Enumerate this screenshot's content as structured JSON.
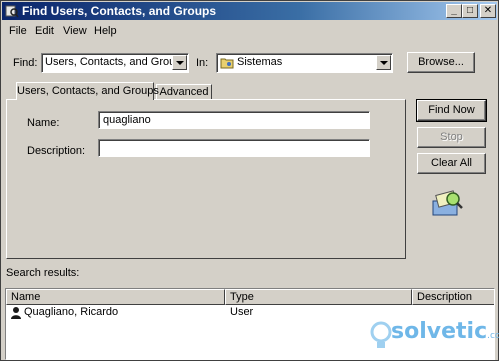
{
  "window": {
    "title": "Find Users, Contacts, and Groups",
    "controls": {
      "minimize": "_",
      "maximize": "□",
      "close": "✕"
    }
  },
  "menubar": {
    "items": [
      "File",
      "Edit",
      "View",
      "Help"
    ]
  },
  "find_row": {
    "find_label": "Find:",
    "find_value": "Users, Contacts, and Groups",
    "in_label": "In:",
    "in_value": "Sistemas",
    "browse_label": "Browse..."
  },
  "tabs": [
    {
      "label": "Users, Contacts, and Groups",
      "active": true
    },
    {
      "label": "Advanced",
      "active": false
    }
  ],
  "form": {
    "name_label": "Name:",
    "name_value": "quagliano",
    "description_label": "Description:",
    "description_value": ""
  },
  "actions": {
    "find_now": "Find Now",
    "stop": "Stop",
    "clear_all": "Clear All"
  },
  "results": {
    "label": "Search results:",
    "columns": [
      "Name",
      "Type",
      "Description"
    ],
    "rows": [
      {
        "name": "Quagliano, Ricardo",
        "type": "User",
        "description": ""
      }
    ]
  },
  "watermark": {
    "text": "solvetic",
    "suffix": ".com"
  },
  "colors": {
    "title_start": "#0a246a",
    "title_end": "#a6caf0",
    "face": "#d4d0c8"
  }
}
